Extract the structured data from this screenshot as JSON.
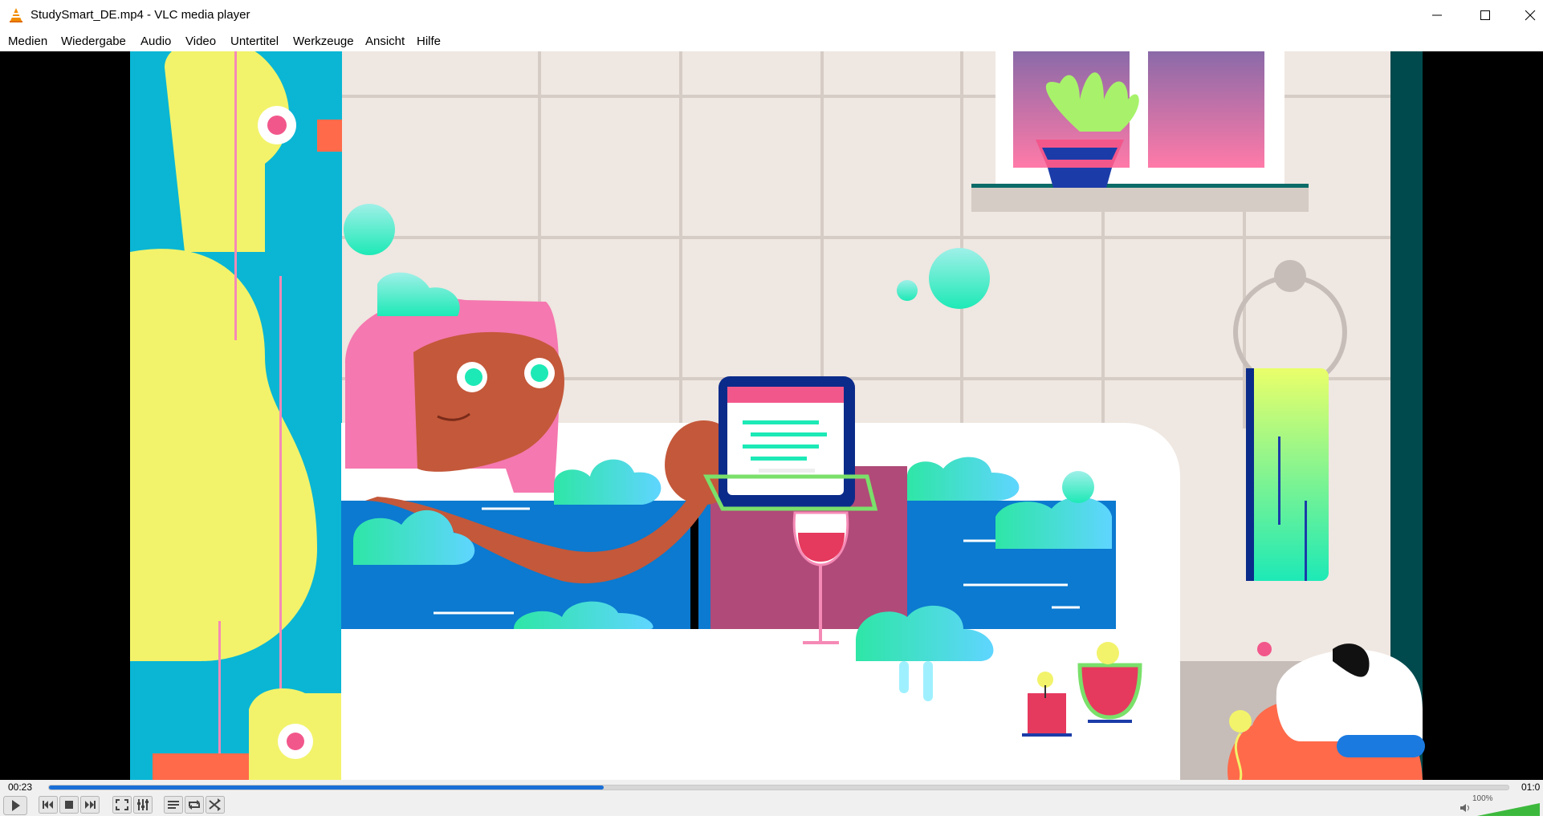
{
  "window": {
    "title": "StudySmart_DE.mp4 - VLC media player"
  },
  "icons": {
    "app": "vlc-cone-icon",
    "minimize": "minimize-icon",
    "maximize": "maximize-icon",
    "close": "close-icon"
  },
  "menu": {
    "items": [
      "Medien",
      "Wiedergabe",
      "Audio",
      "Video",
      "Untertitel",
      "Werkzeuge",
      "Ansicht",
      "Hilfe"
    ]
  },
  "playback": {
    "elapsed": "00:23",
    "total": "01:0",
    "progress_fraction": 0.38,
    "volume_label": "100%",
    "volume_fraction": 1.0
  },
  "colors": {
    "accent": "#1a6fd6",
    "volume": "#3cb93c"
  }
}
